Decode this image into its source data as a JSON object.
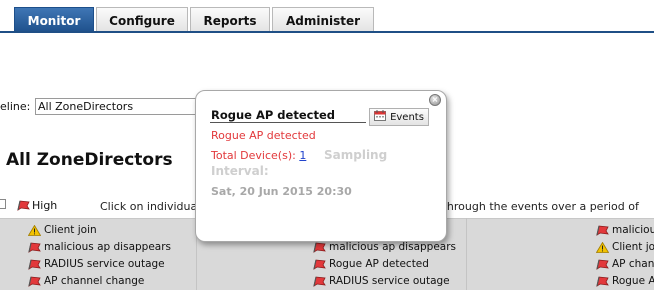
{
  "nav": {
    "tabs": [
      {
        "label": "Monitor",
        "active": true
      },
      {
        "label": "Configure",
        "active": false
      },
      {
        "label": "Reports",
        "active": false
      },
      {
        "label": "Administer",
        "active": false
      }
    ]
  },
  "timeline": {
    "label": "eline:",
    "value": "All ZoneDirectors"
  },
  "page": {
    "title": "All ZoneDirectors"
  },
  "legend": {
    "severity": "High",
    "hint_left": "Click on individua",
    "hint_right": "ll through the events over a period of"
  },
  "events": {
    "col1": [
      "Client join",
      "malicious ap disappears",
      "RADIUS service outage",
      "AP channel change"
    ],
    "col2": [
      "malicious ap disappears",
      "Rogue AP detected",
      "RADIUS service outage"
    ],
    "col3": [
      "maliciou",
      "Client jo",
      "AP chan",
      "Rogue A"
    ]
  },
  "popup": {
    "title": "Rogue AP detected",
    "events_button": "Events",
    "event_name": "Rogue AP detected",
    "total_label": "Total Device(s):",
    "total_value": "1",
    "sampling_a": "Sampling",
    "sampling_b": "Interval:",
    "date": "Sat, 20 Jun 2015 20:30"
  },
  "colors": {
    "nav_active": "#1d4f8a",
    "alert_red": "#e2383b",
    "link_blue": "#2244cc",
    "warning_yellow": "#f2c200"
  }
}
